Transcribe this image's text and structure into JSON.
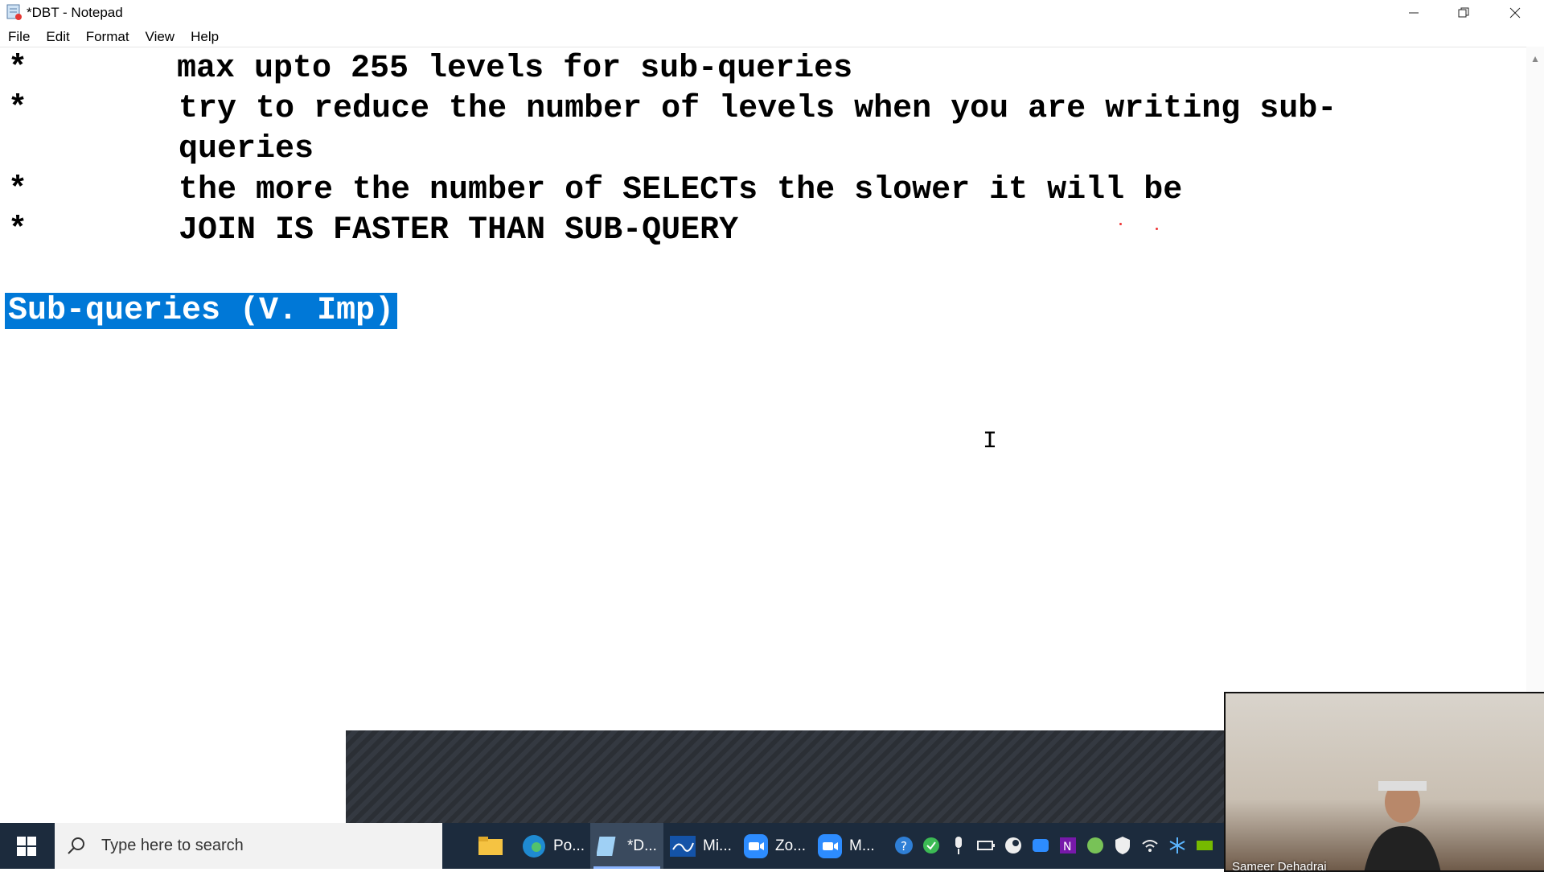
{
  "window": {
    "title": "*DBT - Notepad"
  },
  "menu": [
    {
      "label": "File"
    },
    {
      "label": "Edit"
    },
    {
      "label": "Format"
    },
    {
      "label": "View"
    },
    {
      "label": "Help"
    }
  ],
  "editor": {
    "bullet": "*",
    "lines": [
      "max upto 255 levels for sub-queries",
      "try to reduce the number of levels when you are writing sub-",
      "queries",
      "the more the number of SELECTs the slower it will be",
      "JOIN IS FASTER THAN SUB-QUERY"
    ],
    "selected_text": "Sub-queries (V. Imp)"
  },
  "taskbar": {
    "search_placeholder": "Type here to search",
    "apps": [
      {
        "label": "Po...",
        "icon": "edge-icon"
      },
      {
        "label": "*D...",
        "icon": "notepad-icon"
      },
      {
        "label": "Mi...",
        "icon": "whiteboard-icon"
      },
      {
        "label": "Zo...",
        "icon": "zoom-icon"
      },
      {
        "label": "M...",
        "icon": "zoom-meeting-icon"
      }
    ]
  },
  "webcam": {
    "name": "Sameer Dehadrai"
  },
  "colors": {
    "selection": "#0078d7",
    "taskbar": "#1c2b3d"
  }
}
